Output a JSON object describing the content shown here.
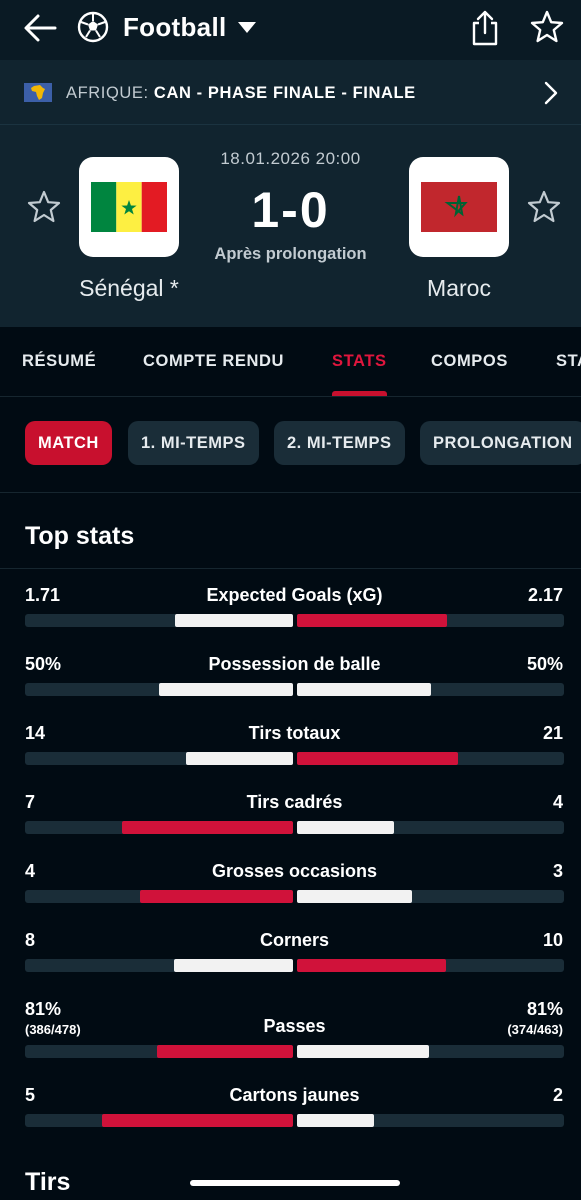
{
  "appbar": {
    "title": "Football",
    "icons": [
      "back-arrow-icon",
      "soccer-ball-icon",
      "chevron-down-icon",
      "share-icon",
      "star-icon"
    ]
  },
  "competition": {
    "region": "AFRIQUE:",
    "name": "CAN - PHASE FINALE - FINALE",
    "flag_icon": "africa-flag-icon"
  },
  "match": {
    "datetime": "18.01.2026 20:00",
    "score": "1-0",
    "status": "Après prolongation",
    "home": {
      "name": "Sénégal *",
      "flag": "senegal-flag"
    },
    "away": {
      "name": "Maroc",
      "flag": "morocco-flag"
    }
  },
  "tabs": [
    {
      "label": "RÉSUMÉ",
      "active": false
    },
    {
      "label": "COMPTE RENDU",
      "active": false
    },
    {
      "label": "STATS",
      "active": true
    },
    {
      "label": "COMPOS",
      "active": false
    },
    {
      "label": "STA",
      "active": false
    }
  ],
  "periods": [
    {
      "label": "MATCH",
      "active": true
    },
    {
      "label": "1. MI-TEMPS",
      "active": false
    },
    {
      "label": "2. MI-TEMPS",
      "active": false
    },
    {
      "label": "PROLONGATION",
      "active": false
    }
  ],
  "sections": {
    "top_stats": "Top stats",
    "next": "Tirs"
  },
  "stats": [
    {
      "label": "Expected Goals (xG)",
      "home": "1.71",
      "away": "2.17",
      "home_value": 1.71,
      "away_value": 2.17
    },
    {
      "label": "Possession de balle",
      "home": "50%",
      "away": "50%",
      "home_value": 50,
      "away_value": 50
    },
    {
      "label": "Tirs totaux",
      "home": "14",
      "away": "21",
      "home_value": 14,
      "away_value": 21
    },
    {
      "label": "Tirs cadrés",
      "home": "7",
      "away": "4",
      "home_value": 7,
      "away_value": 4
    },
    {
      "label": "Grosses occasions",
      "home": "4",
      "away": "3",
      "home_value": 4,
      "away_value": 3
    },
    {
      "label": "Corners",
      "home": "8",
      "away": "10",
      "home_value": 8,
      "away_value": 10
    },
    {
      "label": "Passes",
      "home": "81%",
      "away": "81%",
      "home_sub": "(386/478)",
      "away_sub": "(374/463)",
      "home_value": 386,
      "away_value": 374
    },
    {
      "label": "Cartons jaunes",
      "home": "5",
      "away": "2",
      "home_value": 5,
      "away_value": 2
    }
  ],
  "colors": {
    "accent": "#c8102e",
    "background": "#010b13",
    "header": "#11242f",
    "track": "#1a2d38",
    "trail_bar": "#f2f2f2"
  }
}
